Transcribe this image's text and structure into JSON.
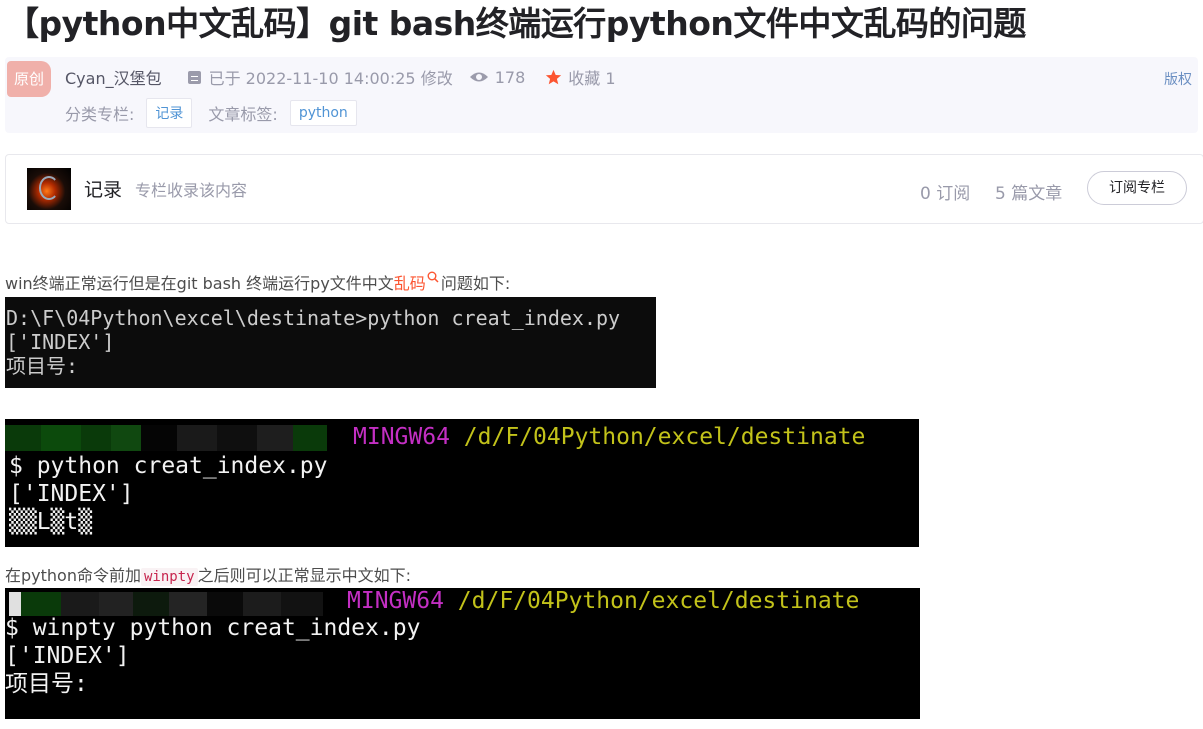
{
  "article": {
    "title": "【python中文乱码】git bash终端运行python文件中文乱码的问题",
    "badge": "原创",
    "author": "Cyan_汉堡包",
    "updated": "已于 2022-11-10 14:00:25 修改",
    "views": "178",
    "favorites": "收藏 1",
    "copyright": "版权",
    "category_label": "分类专栏:",
    "category_tag": "记录",
    "tags_label": "文章标签:",
    "tag": "python"
  },
  "column": {
    "name": "记录",
    "desc": "专栏收录该内容",
    "subscribers": "0 订阅",
    "articles": "5 篇文章",
    "subscribe_button": "订阅专栏"
  },
  "content": {
    "para1_before": "win终端正常运行但是在git bash 终端运行py文件中文",
    "para1_keyword": "乱码",
    "para1_after": "问题如下:",
    "cmd_term": {
      "line1": "D:\\F\\04Python\\excel\\destinate>python creat_index.py",
      "line2": "['INDEX']",
      "line3": "项目号:"
    },
    "gitbash_term": {
      "mingw": "MINGW64",
      "path": "/d/F/04Python/excel/destinate",
      "line1": "$ python creat_index.py",
      "line2": "['INDEX']",
      "line3": "▒▒L▒t▒"
    },
    "para2_before": "在python命令前加",
    "para2_code": "winpty",
    "para2_after": "之后则可以正常显示中文如下:",
    "winpty_term": {
      "mingw": "MINGW64",
      "path": "/d/F/04Python/excel/destinate",
      "line1": "$ winpty python creat_index.py",
      "line2": "['INDEX']",
      "line3": "项目号:"
    }
  },
  "colors": {
    "keyword": "#fc5531",
    "mingw_magenta": "#c32fc3",
    "path_yellow": "#c2c21a",
    "badge_bg": "#f0b0aa",
    "link_blue": "#5094d5"
  }
}
